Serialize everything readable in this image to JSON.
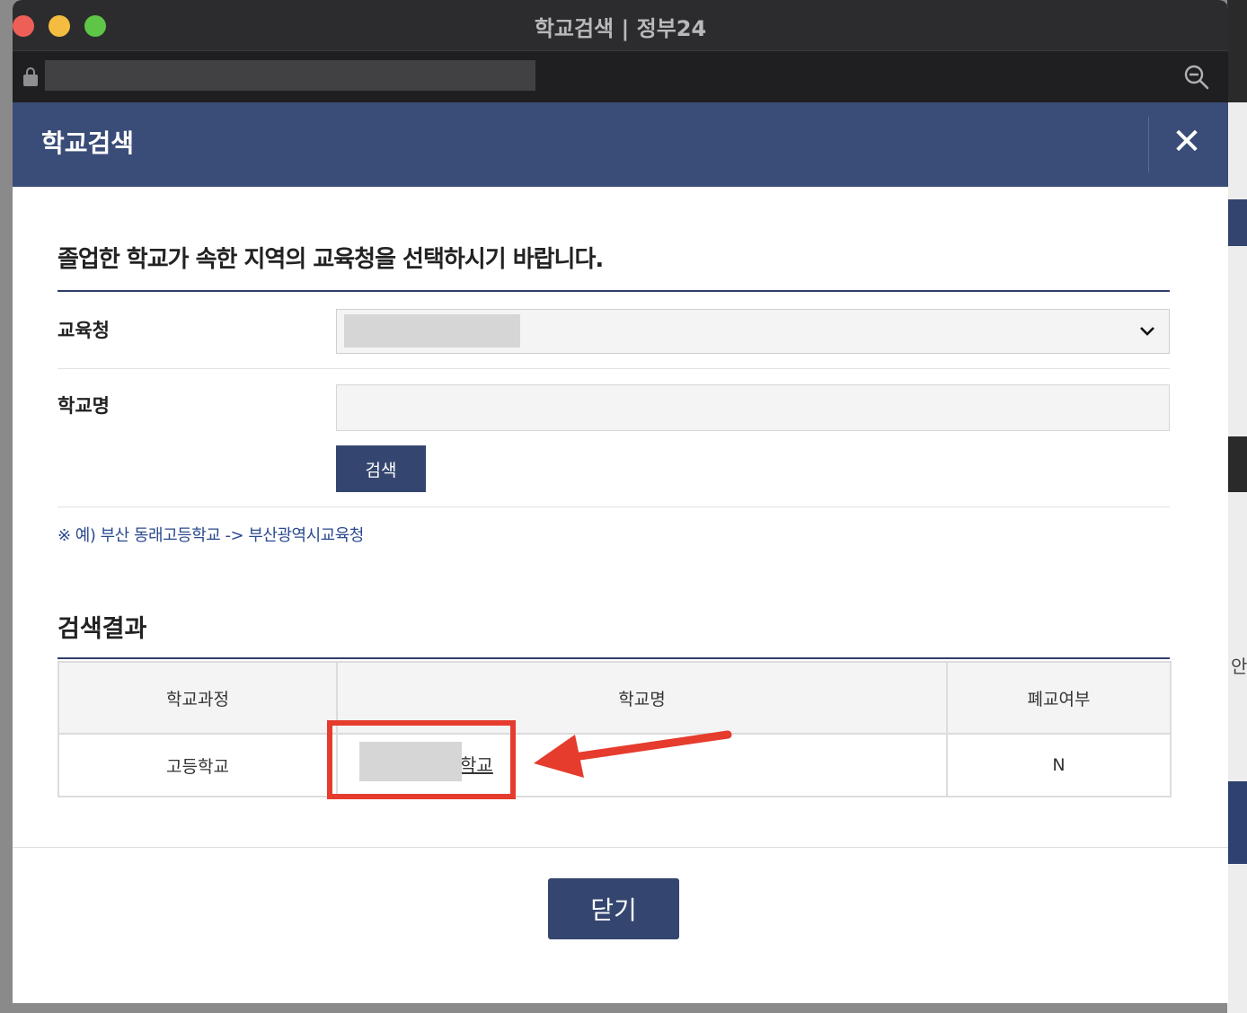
{
  "window": {
    "title": "학교검색 | 정부24"
  },
  "modal": {
    "title": "학교검색",
    "close_symbol": "✕"
  },
  "form": {
    "instruction": "졸업한 학교가 속한 지역의 교육청을 선택하시기 바랍니다.",
    "office_label": "교육청",
    "school_label": "학교명",
    "school_value": "",
    "search_button": "검색",
    "note": "※ 예) 부산 동래고등학교 -> 부산광역시교육청"
  },
  "results": {
    "title": "검색결과",
    "headers": [
      "학교과정",
      "학교명",
      "폐교여부"
    ],
    "rows": [
      {
        "course": "고등학교",
        "school_suffix": "학교",
        "closed": "N"
      }
    ]
  },
  "footer": {
    "close_button": "닫기"
  },
  "background": {
    "partial_text": "안"
  },
  "colors": {
    "navy": "#3a4d78",
    "button": "#34466f",
    "highlight": "#e53c2e"
  }
}
